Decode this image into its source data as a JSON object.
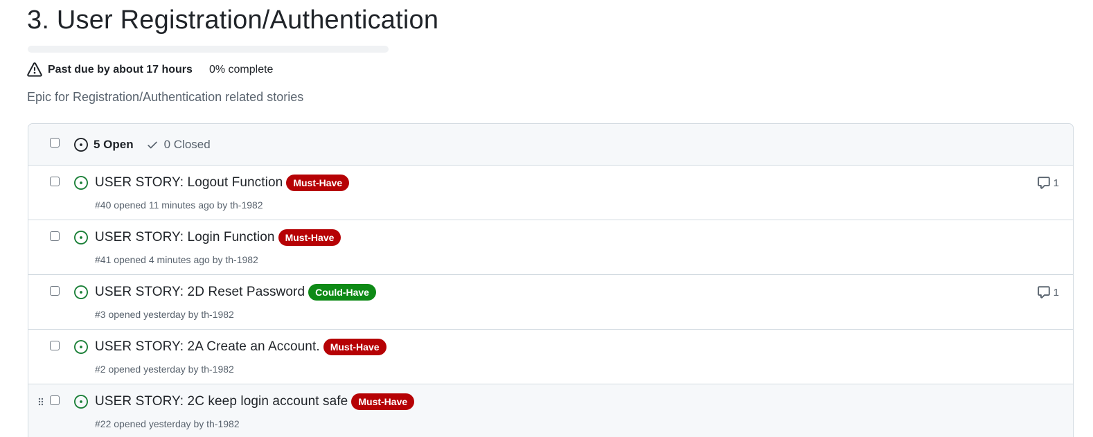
{
  "milestone": {
    "title": "3. User Registration/Authentication",
    "progress_fraction": 0,
    "due_text": "Past due by about 17 hours",
    "percent_value": "0%",
    "percent_suffix": " complete",
    "description": "Epic for Registration/Authentication related stories"
  },
  "filters": {
    "open_label": "5 Open",
    "closed_label": "0 Closed"
  },
  "colors": {
    "open_icon": "#1a7f37",
    "must_have": "#b60205",
    "could_have": "#0e8a16"
  },
  "issues": [
    {
      "title": "USER STORY: Logout Function",
      "label": "Must-Have",
      "label_color": "#b60205",
      "meta": "#40 opened 11 minutes ago by th-1982",
      "comments": "1"
    },
    {
      "title": "USER STORY: Login Function",
      "label": "Must-Have",
      "label_color": "#b60205",
      "meta": "#41 opened 4 minutes ago by th-1982",
      "comments": null
    },
    {
      "title": "USER STORY: 2D Reset Password",
      "label": "Could-Have",
      "label_color": "#0e8a16",
      "meta": "#3 opened yesterday by th-1982",
      "comments": "1"
    },
    {
      "title": "USER STORY: 2A Create an Account.",
      "label": "Must-Have",
      "label_color": "#b60205",
      "meta": "#2 opened yesterday by th-1982",
      "comments": null
    },
    {
      "title": "USER STORY: 2C keep login account safe",
      "label": "Must-Have",
      "label_color": "#b60205",
      "meta": "#22 opened yesterday by th-1982",
      "comments": null
    }
  ]
}
